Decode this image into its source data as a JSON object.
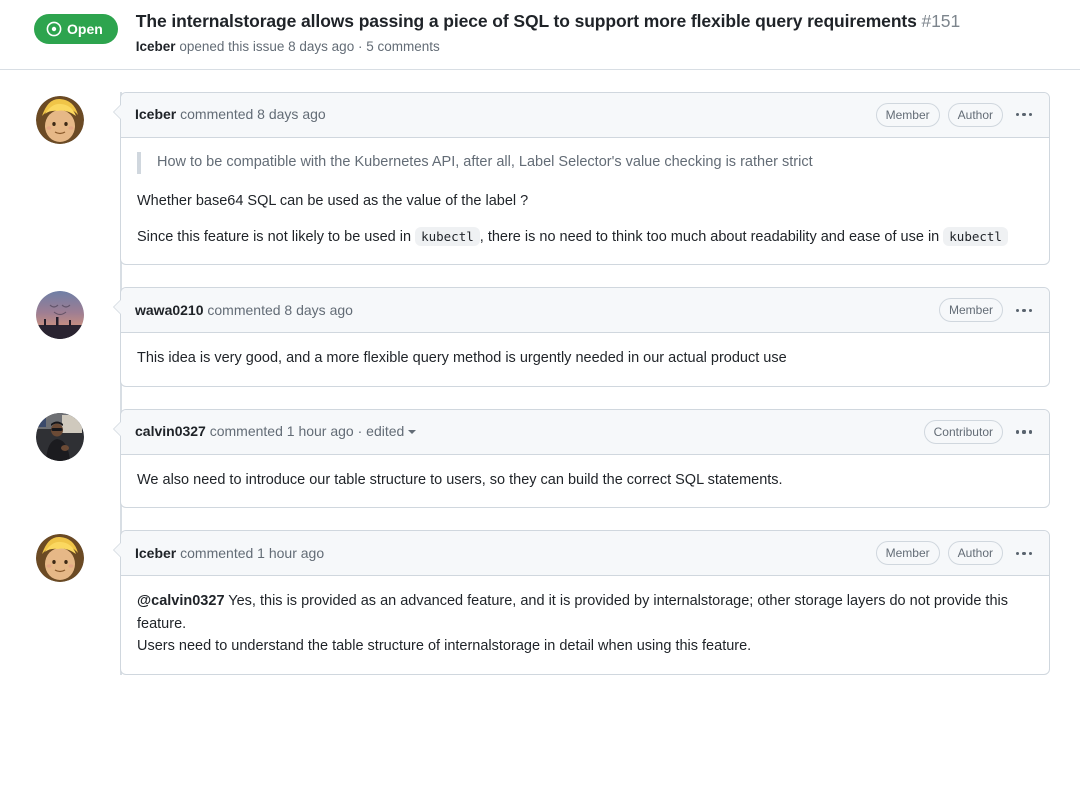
{
  "issue": {
    "state_label": "Open",
    "state_color": "#2da44e",
    "title": "The internalstorage allows passing a piece of SQL to support more flexible query requirements",
    "number": "#151",
    "meta_author": "Iceber",
    "meta_text": "opened this issue 8 days ago · 5 comments"
  },
  "comments": [
    {
      "avatar": "avatar-iceber",
      "user": "Iceber",
      "action": "commented 8 days ago",
      "edited": false,
      "badges": [
        "Member",
        "Author"
      ],
      "menu_icon": "kebab-menu-icon",
      "blockquote": "How to be compatible with the Kubernetes API, after all, Label Selector's value checking is rather strict",
      "paragraphs": [
        "Whether base64 SQL can be used as the value of the label ?"
      ],
      "rich_paragraph": {
        "before": "Since this feature is not likely to be used in ",
        "code1": "kubectl",
        "middle": ", there is no need to think too much about readability and ease of use in ",
        "code2": "kubectl"
      }
    },
    {
      "avatar": "avatar-wawa0210",
      "user": "wawa0210",
      "action": "commented 8 days ago",
      "edited": false,
      "badges": [
        "Member"
      ],
      "menu_icon": "kebab-menu-icon",
      "paragraphs": [
        "This idea is very good, and a more flexible query method is urgently needed in our actual product use"
      ]
    },
    {
      "avatar": "avatar-calvin0327",
      "user": "calvin0327",
      "action": "commented 1 hour ago · edited",
      "edited": true,
      "edited_caret": "chevron-down-icon",
      "badges": [
        "Contributor"
      ],
      "menu_icon": "kebab-menu-icon",
      "paragraphs": [
        "We also need to introduce our table structure to users, so they can build the correct SQL statements."
      ]
    },
    {
      "avatar": "avatar-iceber",
      "user": "Iceber",
      "action": "commented 1 hour ago",
      "edited": false,
      "badges": [
        "Member",
        "Author"
      ],
      "menu_icon": "kebab-menu-icon",
      "mention": "@calvin0327",
      "mention_rest": " Yes, this is provided as an advanced feature, and it is provided by internalstorage; other storage layers do not provide this feature.",
      "paragraphs": [
        "Users need to understand the table structure of internalstorage in detail when using this feature."
      ]
    }
  ]
}
